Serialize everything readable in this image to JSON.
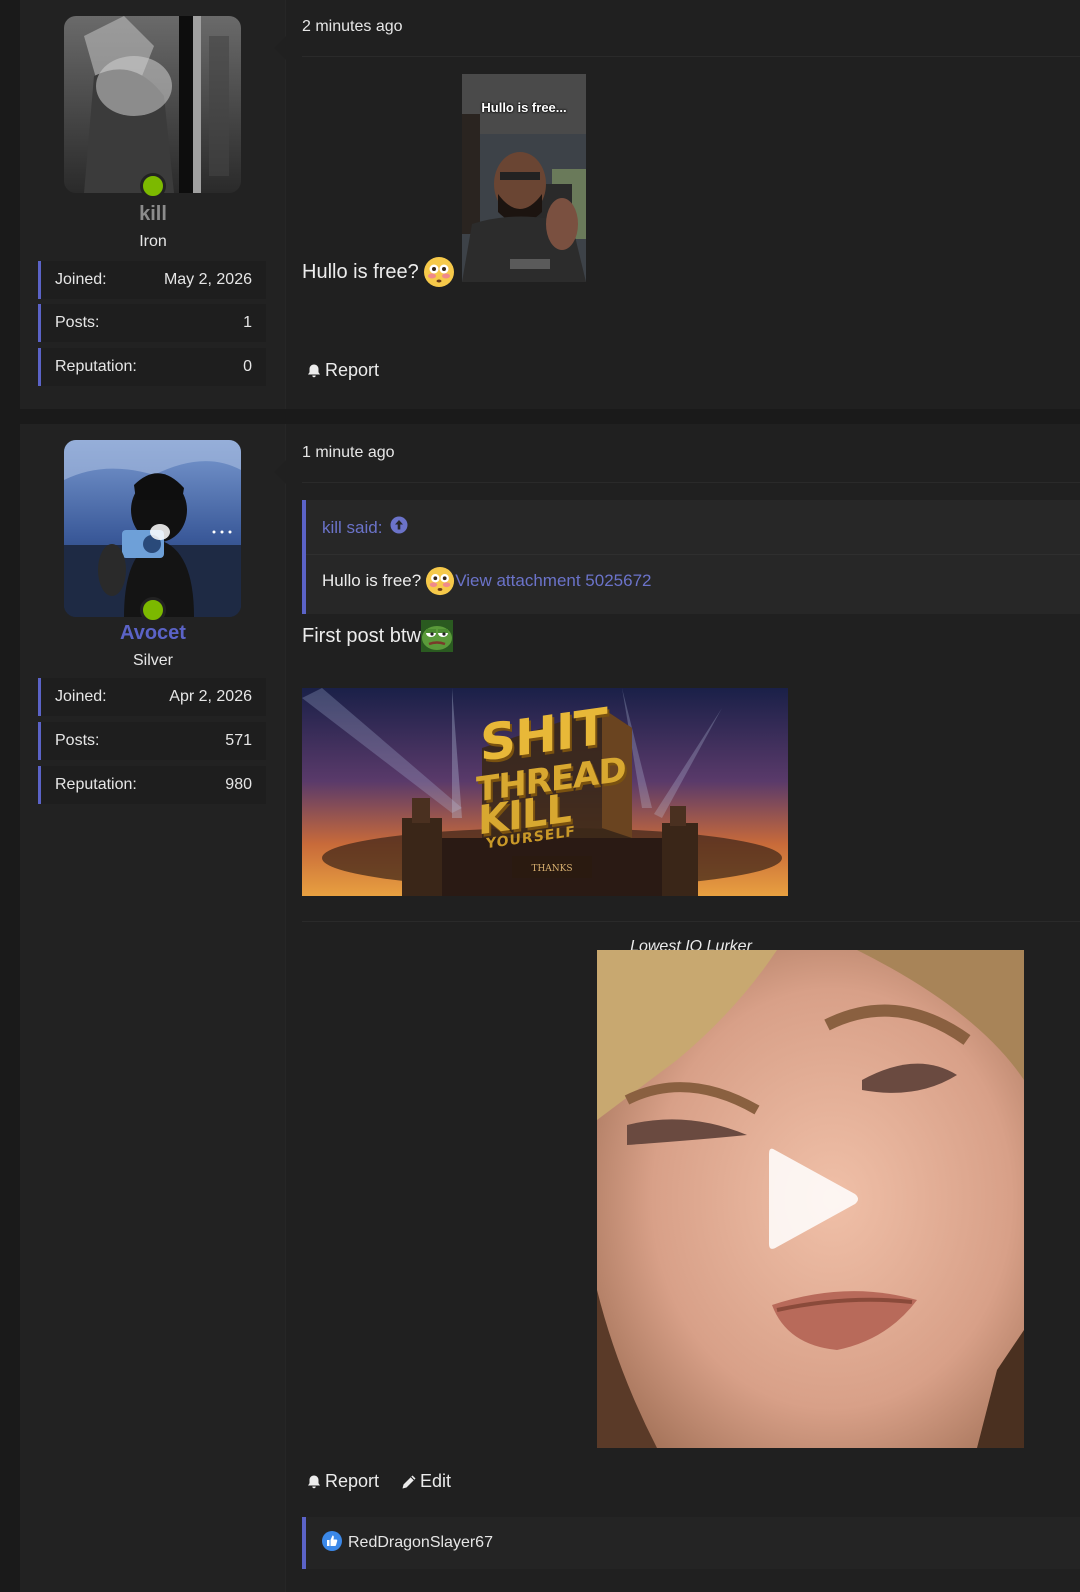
{
  "posts": [
    {
      "user": {
        "name": "kill",
        "rank": "Iron",
        "stats": [
          {
            "label": "Joined:",
            "value": "May 2, 2026"
          },
          {
            "label": "Posts:",
            "value": "1"
          },
          {
            "label": "Reputation:",
            "value": "0"
          }
        ]
      },
      "time": "2 minutes ago",
      "text": "Hullo is free?",
      "thumb_text": "Hullo is free...",
      "actions": {
        "report": "Report"
      }
    },
    {
      "user": {
        "name": "Avocet",
        "rank": "Silver",
        "stats": [
          {
            "label": "Joined:",
            "value": "Apr 2, 2026"
          },
          {
            "label": "Posts:",
            "value": "571"
          },
          {
            "label": "Reputation:",
            "value": "980"
          }
        ]
      },
      "time": "1 minute ago",
      "quote": {
        "author": "kill said:",
        "text": "Hullo is free?",
        "link": "View attachment 5025672"
      },
      "text": "First post btw",
      "banner": {
        "line1": "SHIT",
        "line2": "THREAD",
        "line3": "KILL",
        "line4": "YOURSELF",
        "sign": "THANKS"
      },
      "signature_caption": "Lowest IQ Lurker",
      "actions": {
        "report": "Report",
        "edit": "Edit"
      },
      "reaction_user": "RedDragonSlayer67"
    }
  ],
  "colors": {
    "accent": "#5b63c7",
    "online": "#7cb900",
    "background": "#1a1a1a",
    "panel": "#202020"
  },
  "icons": [
    "bell-icon",
    "pencil-icon",
    "arrow-up-circle-icon",
    "thumbs-up-icon",
    "play-icon",
    "flushed-emoji-icon",
    "pepe-emoji-icon"
  ]
}
